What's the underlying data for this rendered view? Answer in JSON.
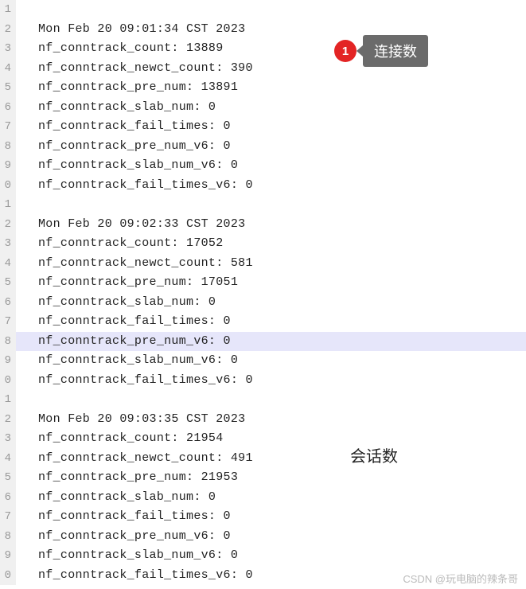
{
  "gutter": [
    "1",
    "2",
    "3",
    "4",
    "5",
    "6",
    "7",
    "8",
    "9",
    "0",
    "1",
    "2",
    "3",
    "4",
    "5",
    "6",
    "7",
    "8",
    "9",
    "0",
    "1",
    "2",
    "3",
    "4",
    "5",
    "6",
    "7",
    "8",
    "9",
    "0"
  ],
  "lines": {
    "l0": "",
    "l1": "Mon Feb 20 09:01:34 CST 2023",
    "l2": "nf_conntrack_count: 13889",
    "l3": "nf_conntrack_newct_count: 390",
    "l4": "nf_conntrack_pre_num: 13891",
    "l5": "nf_conntrack_slab_num: 0",
    "l6": "nf_conntrack_fail_times: 0",
    "l7": "nf_conntrack_pre_num_v6: 0",
    "l8": "nf_conntrack_slab_num_v6: 0",
    "l9": "nf_conntrack_fail_times_v6: 0",
    "l10": "",
    "l11": "Mon Feb 20 09:02:33 CST 2023",
    "l12": "nf_conntrack_count: 17052",
    "l13": "nf_conntrack_newct_count: 581",
    "l14": "nf_conntrack_pre_num: 17051",
    "l15": "nf_conntrack_slab_num: 0",
    "l16": "nf_conntrack_fail_times: 0",
    "l17": "nf_conntrack_pre_num_v6: 0",
    "l18": "nf_conntrack_slab_num_v6: 0",
    "l19": "nf_conntrack_fail_times_v6: 0",
    "l20": "",
    "l21": "Mon Feb 20 09:03:35 CST 2023",
    "l22": "nf_conntrack_count: 21954",
    "l23": "nf_conntrack_newct_count: 491",
    "l24": "nf_conntrack_pre_num: 21953",
    "l25": "nf_conntrack_slab_num: 0",
    "l26": "nf_conntrack_fail_times: 0",
    "l27": "nf_conntrack_pre_num_v6: 0",
    "l28": "nf_conntrack_slab_num_v6: 0",
    "l29": "nf_conntrack_fail_times_v6: 0"
  },
  "callout": {
    "badge": "1",
    "text": "连接数"
  },
  "annotation": "会话数",
  "watermark": "CSDN @玩电脑的辣条哥"
}
